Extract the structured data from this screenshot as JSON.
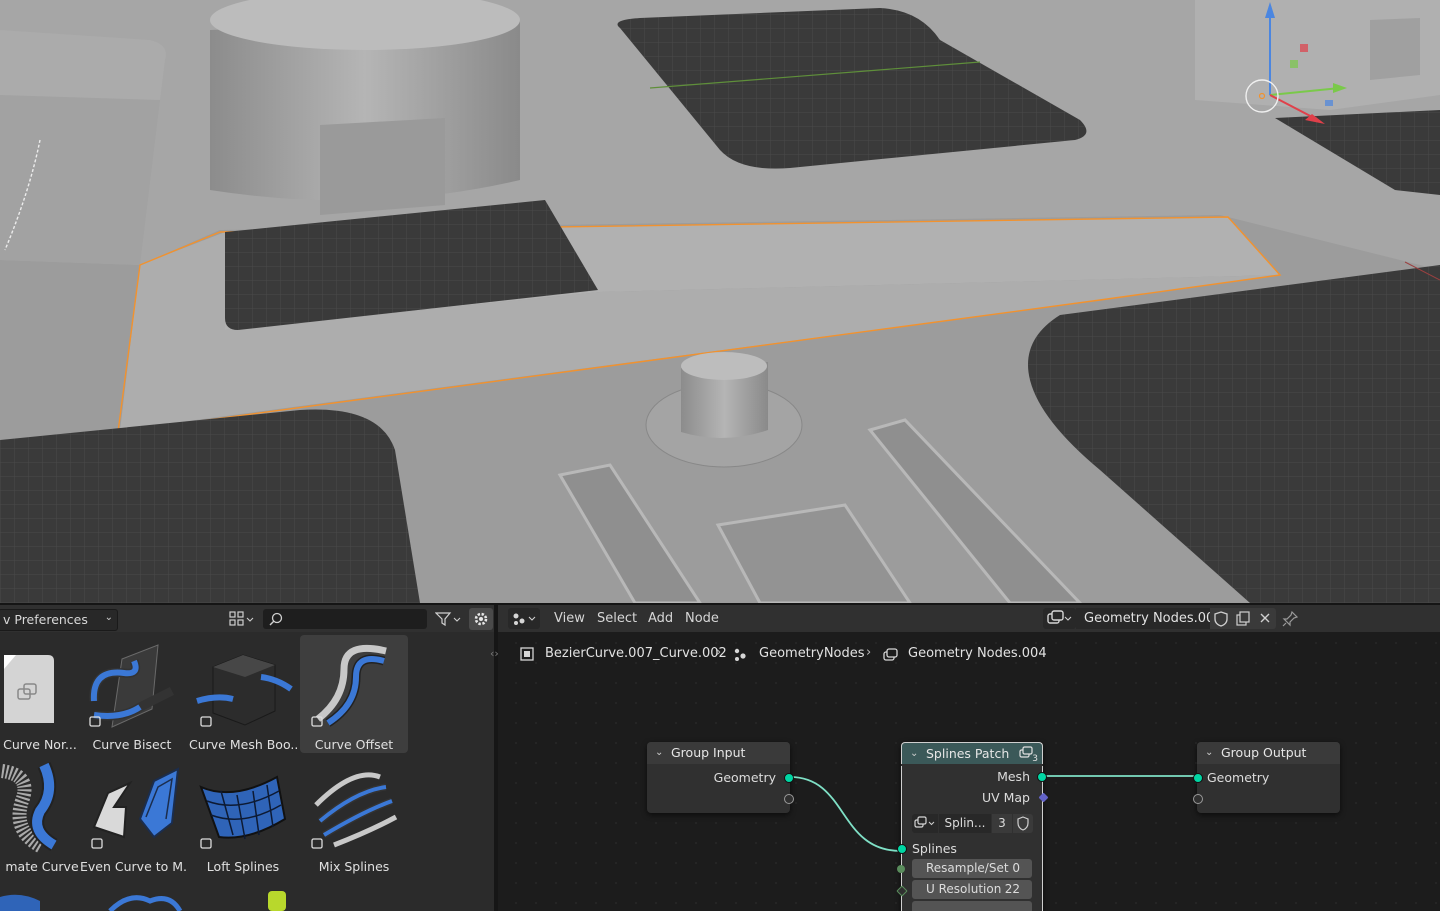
{
  "asset_browser": {
    "library_dropdown": "v Preferences",
    "search": {
      "value": "",
      "placeholder": ""
    },
    "assets": [
      {
        "label": "Curve Nor..."
      },
      {
        "label": "Curve Bisect"
      },
      {
        "label": "Curve Mesh Boo..."
      },
      {
        "label": "Curve Offset",
        "selected": true
      },
      {
        "label": "mate Curve"
      },
      {
        "label": "Even Curve to M..."
      },
      {
        "label": "Loft Splines"
      },
      {
        "label": "Mix Splines"
      }
    ]
  },
  "node_editor": {
    "menu": [
      "View",
      "Select",
      "Add",
      "Node"
    ],
    "node_group_name": "Geometry Nodes.004",
    "breadcrumb": [
      "BezierCurve.007_Curve.002",
      "GeometryNodes",
      "Geometry Nodes.004"
    ],
    "nodes": {
      "group_input": {
        "title": "Group Input",
        "outputs": [
          "Geometry"
        ]
      },
      "splines_patch": {
        "title": "Splines Patch",
        "badge": "3",
        "outputs": [
          "Mesh",
          "UV Map"
        ],
        "subgroup": {
          "name": "Splin...",
          "users": "3"
        },
        "inputs": [
          "Splines"
        ],
        "fields": [
          {
            "label": "Resample/Set",
            "value": "0"
          },
          {
            "label": "U Resolution",
            "value": "22"
          }
        ]
      },
      "group_output": {
        "title": "Group Output",
        "inputs": [
          "Geometry"
        ]
      }
    }
  },
  "colors": {
    "selection_outline": "#f2922e",
    "geometry_socket": "#00d6a3",
    "vector_socket": "#6363c7",
    "node_header_geometry": "#3b5959",
    "link": "#7fe0c6"
  }
}
